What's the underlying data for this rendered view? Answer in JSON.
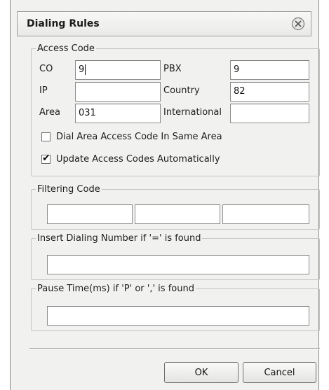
{
  "dialog": {
    "title": "Dialing Rules",
    "close_icon": "close-circle-x-icon"
  },
  "access_code": {
    "legend": "Access Code",
    "co_label": "CO",
    "co_value": "9",
    "pbx_label": "PBX",
    "pbx_value": "9",
    "ip_label": "IP",
    "ip_value": "",
    "country_label": "Country",
    "country_value": "82",
    "area_label": "Area",
    "area_value": "031",
    "international_label": "International",
    "international_value": "",
    "dial_area_label": "Dial Area Access Code In Same Area",
    "dial_area_checked": false,
    "update_codes_label": "Update Access Codes Automatically",
    "update_codes_checked": true
  },
  "filtering_code": {
    "legend": "Filtering Code",
    "values": [
      "",
      "",
      ""
    ]
  },
  "insert_dialing": {
    "legend": "Insert Dialing Number if '=' is found",
    "value": ""
  },
  "pause_time": {
    "legend": "Pause Time(ms) if 'P' or ',' is found",
    "value": ""
  },
  "buttons": {
    "ok_label": "OK",
    "cancel_label": "Cancel"
  }
}
